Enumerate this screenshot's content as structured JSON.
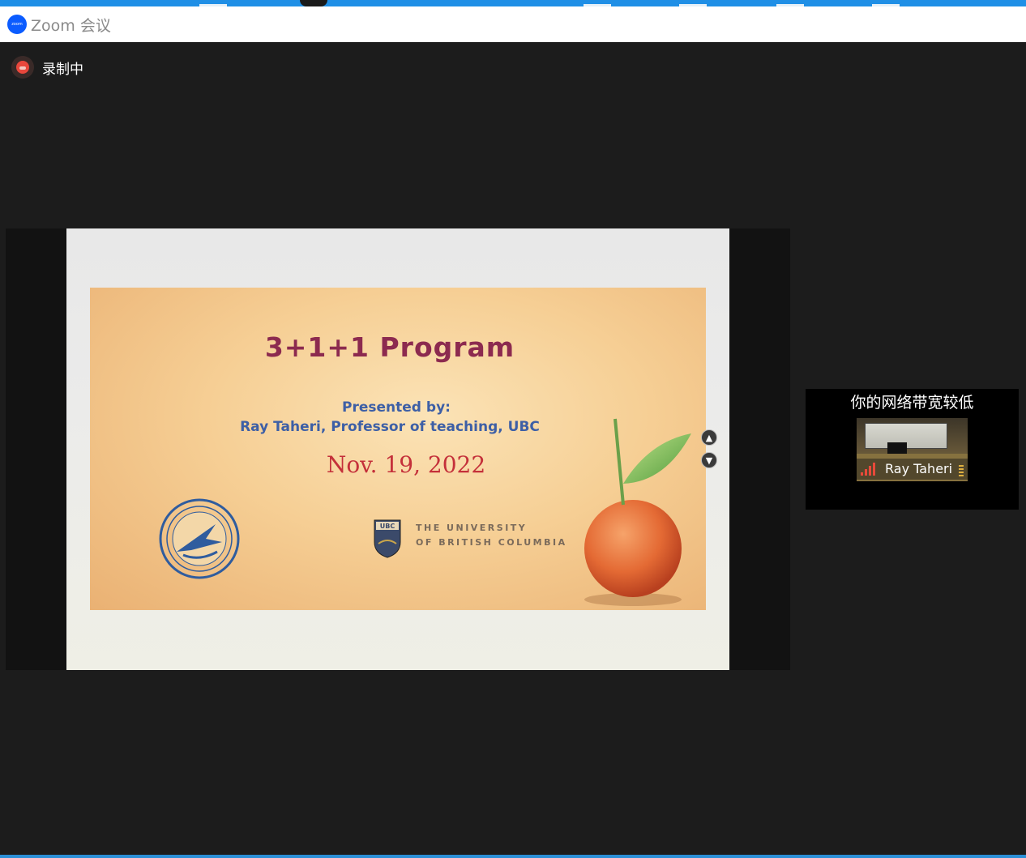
{
  "window": {
    "title": "Zoom 会议",
    "logo_text": "zoom"
  },
  "recording": {
    "label": "录制中"
  },
  "share": {
    "slide": {
      "title": "3+1+1 Program",
      "presented_by": "Presented by:",
      "presenter": "Ray Taheri, Professor of teaching, UBC",
      "date": "Nov. 19, 2022",
      "university_line1": "THE UNIVERSITY",
      "university_line2": "OF BRITISH COLUMBIA",
      "ubc_shield_text": "UBC"
    },
    "controls": {
      "up_icon": "chevron-up-icon",
      "down_icon": "chevron-down-icon"
    }
  },
  "bandwidth_panel": {
    "warning": "你的网络带宽较低",
    "participant_name": "Ray Taheri",
    "signal_icon": "signal-bars-icon"
  },
  "colors": {
    "titlebar_accent": "#1f8fe6",
    "zoom_blue": "#0b5cff",
    "recording_red": "#e8473c",
    "slide_title": "#8c2a4f",
    "slide_blue_text": "#3d5fa6",
    "slide_date": "#c4303a",
    "signal_red": "#e84a3a"
  }
}
